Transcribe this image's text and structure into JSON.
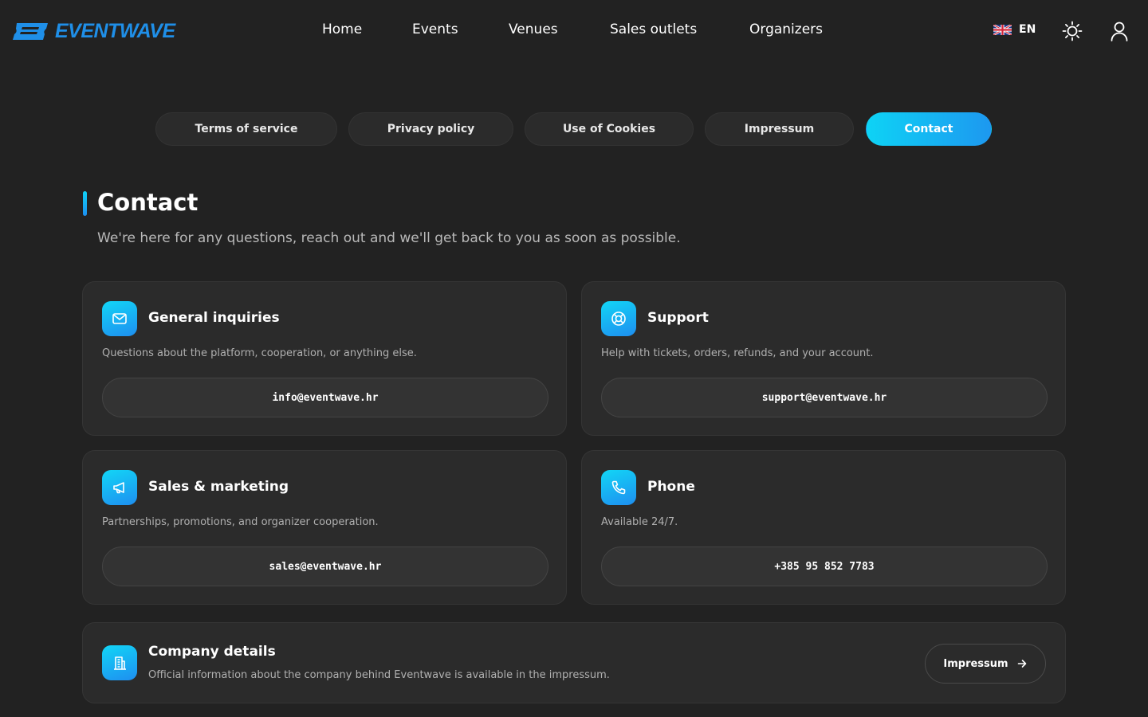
{
  "brand": {
    "name": "EVENTWAVE",
    "color": "#1f8fe8"
  },
  "nav": {
    "links": [
      {
        "label": "Home"
      },
      {
        "label": "Events"
      },
      {
        "label": "Venues"
      },
      {
        "label": "Sales outlets"
      },
      {
        "label": "Organizers"
      }
    ],
    "language": {
      "code": "EN",
      "flag_icon": "uk-flag-icon"
    },
    "theme_icon": "sun-icon",
    "account_icon": "user-icon"
  },
  "tabs": [
    {
      "label": "Terms of service",
      "active": false
    },
    {
      "label": "Privacy policy",
      "active": false
    },
    {
      "label": "Use of Cookies",
      "active": false
    },
    {
      "label": "Impressum",
      "active": false
    },
    {
      "label": "Contact",
      "active": true
    }
  ],
  "page": {
    "title": "Contact",
    "subtitle": "We're here for any questions, reach out and we'll get back to you as soon as possible."
  },
  "cards": [
    {
      "icon": "mail-icon",
      "title": "General inquiries",
      "description": "Questions about the platform, cooperation, or anything else.",
      "value": "info@eventwave.hr"
    },
    {
      "icon": "lifebuoy-icon",
      "title": "Support",
      "description": "Help with tickets, orders, refunds, and your account.",
      "value": "support@eventwave.hr"
    },
    {
      "icon": "megaphone-icon",
      "title": "Sales & marketing",
      "description": "Partnerships, promotions, and organizer cooperation.",
      "value": "sales@eventwave.hr"
    },
    {
      "icon": "phone-icon",
      "title": "Phone",
      "description": "Available 24/7.",
      "value": "+385 95 852 7783"
    }
  ],
  "company": {
    "icon": "building-icon",
    "title": "Company details",
    "description": "Official information about the company behind Eventwave is available in the impressum.",
    "button_label": "Impressum"
  },
  "colors": {
    "background": "#222222",
    "card": "#2b2b2b",
    "accent_start": "#0ed3f5",
    "accent_end": "#1d98f0"
  }
}
